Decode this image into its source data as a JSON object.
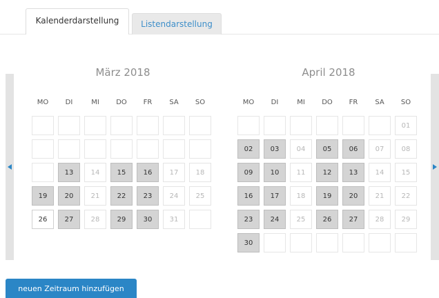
{
  "tabs": [
    {
      "label": "Kalenderdarstellung",
      "active": true
    },
    {
      "label": "Listendarstellung",
      "active": false
    }
  ],
  "nav": {
    "prev_icon": "chevron-left-icon",
    "next_icon": "chevron-right-icon"
  },
  "weekdays": [
    "MO",
    "DI",
    "MI",
    "DO",
    "FR",
    "SA",
    "SO"
  ],
  "months": [
    {
      "title": "März 2018",
      "cells": [
        {
          "day": "",
          "state": "blank"
        },
        {
          "day": "",
          "state": "blank"
        },
        {
          "day": "",
          "state": "blank"
        },
        {
          "day": "",
          "state": "blank"
        },
        {
          "day": "",
          "state": "blank"
        },
        {
          "day": "",
          "state": "blank"
        },
        {
          "day": "",
          "state": "blank"
        },
        {
          "day": "",
          "state": "blank"
        },
        {
          "day": "",
          "state": "blank"
        },
        {
          "day": "",
          "state": "blank"
        },
        {
          "day": "",
          "state": "blank"
        },
        {
          "day": "",
          "state": "blank"
        },
        {
          "day": "",
          "state": "blank"
        },
        {
          "day": "",
          "state": "blank"
        },
        {
          "day": "",
          "state": "blank"
        },
        {
          "day": "13",
          "state": "sel"
        },
        {
          "day": "14",
          "state": "dim"
        },
        {
          "day": "15",
          "state": "sel"
        },
        {
          "day": "16",
          "state": "sel"
        },
        {
          "day": "17",
          "state": "dim"
        },
        {
          "day": "18",
          "state": "dim"
        },
        {
          "day": "19",
          "state": "sel"
        },
        {
          "day": "20",
          "state": "sel"
        },
        {
          "day": "21",
          "state": "dim"
        },
        {
          "day": "22",
          "state": "sel"
        },
        {
          "day": "23",
          "state": "sel"
        },
        {
          "day": "24",
          "state": "dim"
        },
        {
          "day": "25",
          "state": "dim"
        },
        {
          "day": "26",
          "state": "open"
        },
        {
          "day": "27",
          "state": "sel"
        },
        {
          "day": "28",
          "state": "dim"
        },
        {
          "day": "29",
          "state": "sel"
        },
        {
          "day": "30",
          "state": "sel"
        },
        {
          "day": "31",
          "state": "dim"
        },
        {
          "day": "",
          "state": "blank"
        }
      ]
    },
    {
      "title": "April 2018",
      "cells": [
        {
          "day": "",
          "state": "blank"
        },
        {
          "day": "",
          "state": "blank"
        },
        {
          "day": "",
          "state": "blank"
        },
        {
          "day": "",
          "state": "blank"
        },
        {
          "day": "",
          "state": "blank"
        },
        {
          "day": "",
          "state": "blank"
        },
        {
          "day": "01",
          "state": "dim"
        },
        {
          "day": "02",
          "state": "sel"
        },
        {
          "day": "03",
          "state": "sel"
        },
        {
          "day": "04",
          "state": "dim"
        },
        {
          "day": "05",
          "state": "sel"
        },
        {
          "day": "06",
          "state": "sel"
        },
        {
          "day": "07",
          "state": "dim"
        },
        {
          "day": "08",
          "state": "dim"
        },
        {
          "day": "09",
          "state": "sel"
        },
        {
          "day": "10",
          "state": "sel"
        },
        {
          "day": "11",
          "state": "dim"
        },
        {
          "day": "12",
          "state": "sel"
        },
        {
          "day": "13",
          "state": "sel"
        },
        {
          "day": "14",
          "state": "dim"
        },
        {
          "day": "15",
          "state": "dim"
        },
        {
          "day": "16",
          "state": "sel"
        },
        {
          "day": "17",
          "state": "sel"
        },
        {
          "day": "18",
          "state": "dim"
        },
        {
          "day": "19",
          "state": "sel"
        },
        {
          "day": "20",
          "state": "sel"
        },
        {
          "day": "21",
          "state": "dim"
        },
        {
          "day": "22",
          "state": "dim"
        },
        {
          "day": "23",
          "state": "sel"
        },
        {
          "day": "24",
          "state": "sel"
        },
        {
          "day": "25",
          "state": "dim"
        },
        {
          "day": "26",
          "state": "sel"
        },
        {
          "day": "27",
          "state": "sel"
        },
        {
          "day": "28",
          "state": "dim"
        },
        {
          "day": "29",
          "state": "dim"
        },
        {
          "day": "30",
          "state": "sel"
        },
        {
          "day": "",
          "state": "blank"
        },
        {
          "day": "",
          "state": "blank"
        },
        {
          "day": "",
          "state": "blank"
        },
        {
          "day": "",
          "state": "blank"
        },
        {
          "day": "",
          "state": "blank"
        },
        {
          "day": "",
          "state": "blank"
        }
      ]
    }
  ],
  "add_button": {
    "label": "neuen Zeitraum hinzufügen"
  },
  "colors": {
    "accent": "#2b86c6",
    "link": "#3d8ec9",
    "selected_day": "#d4d4d4",
    "nav_bar": "#e3e3e3"
  }
}
